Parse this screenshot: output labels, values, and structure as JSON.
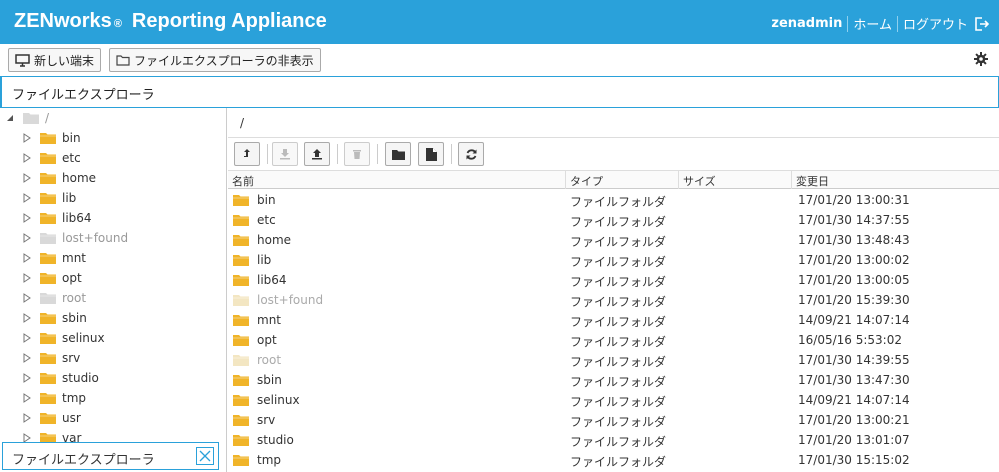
{
  "header": {
    "brand": "ZENworks",
    "reg_mark": "®",
    "product": "Reporting Appliance",
    "user": "zenadmin",
    "home": "ホーム",
    "logout": "ログアウト"
  },
  "toolbar": {
    "new_terminal": "新しい端末",
    "hide_explorer": "ファイルエクスプローラの非表示"
  },
  "panel_title": "ファイルエクスプローラ",
  "tree": {
    "root": "/",
    "items": [
      {
        "name": "bin",
        "dim": false
      },
      {
        "name": "etc",
        "dim": false
      },
      {
        "name": "home",
        "dim": false
      },
      {
        "name": "lib",
        "dim": false
      },
      {
        "name": "lib64",
        "dim": false
      },
      {
        "name": "lost+found",
        "dim": true
      },
      {
        "name": "mnt",
        "dim": false
      },
      {
        "name": "opt",
        "dim": false
      },
      {
        "name": "root",
        "dim": true
      },
      {
        "name": "sbin",
        "dim": false
      },
      {
        "name": "selinux",
        "dim": false
      },
      {
        "name": "srv",
        "dim": false
      },
      {
        "name": "studio",
        "dim": false
      },
      {
        "name": "tmp",
        "dim": false
      },
      {
        "name": "usr",
        "dim": false
      },
      {
        "name": "var",
        "dim": false
      }
    ]
  },
  "fileview": {
    "path": "/",
    "columns": {
      "name": "名前",
      "type": "タイプ",
      "size": "サイズ",
      "modified": "変更日"
    },
    "rows": [
      {
        "name": "bin",
        "type": "ファイルフォルダ",
        "size": "",
        "modified": "17/01/20 13:00:31",
        "dim": false
      },
      {
        "name": "etc",
        "type": "ファイルフォルダ",
        "size": "",
        "modified": "17/01/30 14:37:55",
        "dim": false
      },
      {
        "name": "home",
        "type": "ファイルフォルダ",
        "size": "",
        "modified": "17/01/30 13:48:43",
        "dim": false
      },
      {
        "name": "lib",
        "type": "ファイルフォルダ",
        "size": "",
        "modified": "17/01/20 13:00:02",
        "dim": false
      },
      {
        "name": "lib64",
        "type": "ファイルフォルダ",
        "size": "",
        "modified": "17/01/20 13:00:05",
        "dim": false
      },
      {
        "name": "lost+found",
        "type": "ファイルフォルダ",
        "size": "",
        "modified": "17/01/20 15:39:30",
        "dim": true
      },
      {
        "name": "mnt",
        "type": "ファイルフォルダ",
        "size": "",
        "modified": "14/09/21 14:07:14",
        "dim": false
      },
      {
        "name": "opt",
        "type": "ファイルフォルダ",
        "size": "",
        "modified": "16/05/16 5:53:02",
        "dim": false
      },
      {
        "name": "root",
        "type": "ファイルフォルダ",
        "size": "",
        "modified": "17/01/30 14:39:55",
        "dim": true
      },
      {
        "name": "sbin",
        "type": "ファイルフォルダ",
        "size": "",
        "modified": "17/01/30 13:47:30",
        "dim": false
      },
      {
        "name": "selinux",
        "type": "ファイルフォルダ",
        "size": "",
        "modified": "14/09/21 14:07:14",
        "dim": false
      },
      {
        "name": "srv",
        "type": "ファイルフォルダ",
        "size": "",
        "modified": "17/01/20 13:00:21",
        "dim": false
      },
      {
        "name": "studio",
        "type": "ファイルフォルダ",
        "size": "",
        "modified": "17/01/20 13:01:07",
        "dim": false
      },
      {
        "name": "tmp",
        "type": "ファイルフォルダ",
        "size": "",
        "modified": "17/01/30 15:15:02",
        "dim": false
      }
    ]
  },
  "bottom_tab": {
    "label": "ファイルエクスプローラ"
  },
  "colors": {
    "accent": "#2aa1da",
    "folder": "#f0b429",
    "folder_dim": "#d9d9d9"
  }
}
